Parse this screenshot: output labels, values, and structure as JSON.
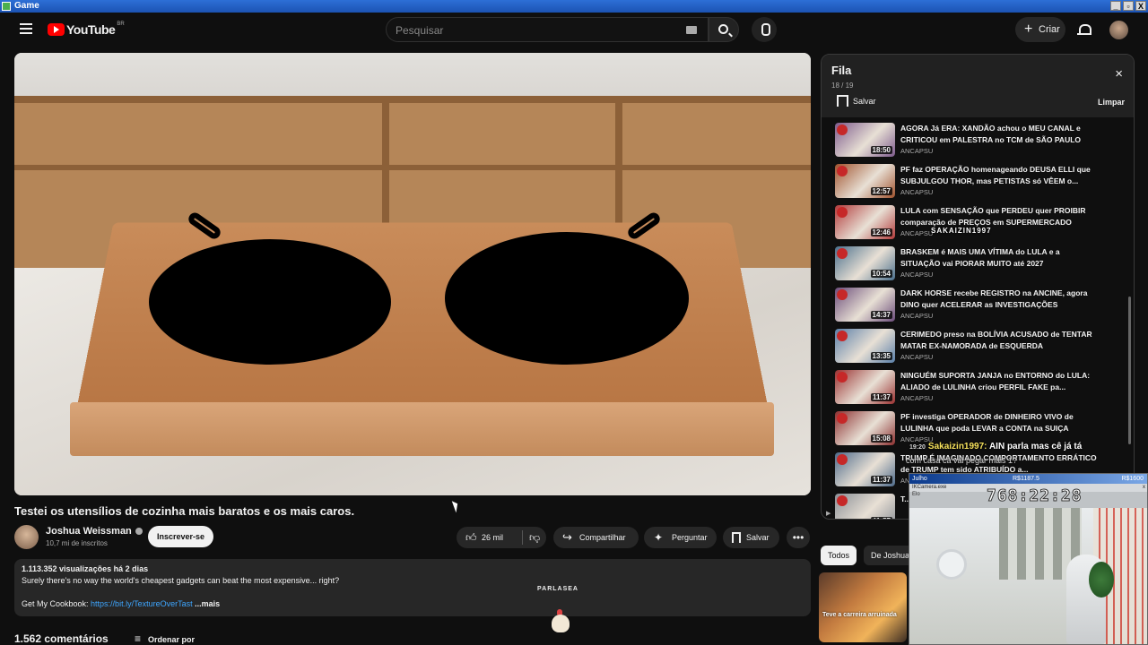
{
  "window": {
    "title": "Game",
    "controls": [
      "_",
      "▫",
      "X"
    ]
  },
  "header": {
    "logo_text": "YouTube",
    "country_code": "BR",
    "search_placeholder": "Pesquisar",
    "create_label": "Criar"
  },
  "video": {
    "title": "Testei os utensílios de cozinha mais baratos e os mais caros.",
    "channel": "Joshua Weissman",
    "subscribers": "10,7 mi de inscritos",
    "subscribe_label": "Inscrever-se",
    "likes": "26 mil",
    "share_label": "Compartilhar",
    "ask_label": "Perguntar",
    "save_label": "Salvar",
    "more_label": "•••"
  },
  "description": {
    "stats": "1.113.352 visualizações  há 2 dias",
    "text": "Surely there's no way the world's cheapest gadgets can beat the most expensive... right?",
    "cookbook_prefix": "Get My Cookbook: ",
    "cookbook_link": "https://bit.ly/TextureOverTast",
    "more": "...mais"
  },
  "comments": {
    "count": "1.562 comentários",
    "sort_label": "Ordenar por"
  },
  "queue": {
    "title": "Fila",
    "position": "18 / 19",
    "save_label": "Salvar",
    "clear_label": "Limpar",
    "close_icon": "×",
    "items": [
      {
        "title": "AGORA Já ERA: XANDÃO achou o MEU CANAL e CRITICOU em PALESTRA no TCM de SÃO PAULO",
        "channel": "ANCAPSU",
        "duration": "18:50",
        "thumb_color": "#7d5a8c"
      },
      {
        "title": "PF faz OPERAÇÃO homenageando DEUSA ELLI que SUBJULGOU THOR, mas PETISTAS só VÊEM o...",
        "channel": "ANCAPSU",
        "duration": "12:57",
        "thumb_color": "#a0522d"
      },
      {
        "title": "LULA com SENSAÇÃO que PERDEU quer PROIBIR comparação de PREÇOS em SUPERMERCADO",
        "channel": "ANCAPSU",
        "duration": "12:46",
        "thumb_color": "#b23a3a"
      },
      {
        "title": "BRASKEM é MAIS UMA VÍTIMA do LULA e a SITUAÇÃO vai PIORAR MUITO até 2027",
        "channel": "ANCAPSU",
        "duration": "10:54",
        "thumb_color": "#4a6f8c"
      },
      {
        "title": "DARK HORSE recebe REGISTRO na ANCINE, agora DINO quer ACELERAR as INVESTIGAÇÕES",
        "channel": "ANCAPSU",
        "duration": "14:37",
        "thumb_color": "#6b4c7a"
      },
      {
        "title": "CERIMEDO preso na BOLÍVIA ACUSADO de TENTAR MATAR EX-NAMORADA de ESQUERDA",
        "channel": "ANCAPSU",
        "duration": "13:35",
        "thumb_color": "#5a7fa8"
      },
      {
        "title": "NINGUÉM SUPORTA JANJA no ENTORNO do LULA: ALIADO de LULINHA criou PERFIL FAKE pa...",
        "channel": "ANCAPSU",
        "duration": "11:37",
        "thumb_color": "#9a3030"
      },
      {
        "title": "PF investiga OPERADOR de DINHEIRO VIVO de LULINHA que poda LEVAR a CONTA na SUIÇA",
        "channel": "ANCAPSU",
        "duration": "15:08",
        "thumb_color": "#8c2f2f"
      },
      {
        "title": "TRUMP É IMAGINADO COMPORTAMENTO ERRÁTICO de TRUMP tem sido ATRIBUÍDO a...",
        "channel": "ANCAPSU",
        "duration": "11:37",
        "thumb_color": "#4d6a8a"
      },
      {
        "title": "T...",
        "channel": "",
        "duration": "41:57",
        "thumb_color": "#8a8f96"
      }
    ]
  },
  "chips": {
    "all": "Todos",
    "other": "De Joshua"
  },
  "recommendation": {
    "title_overlay": "Teve a carreira arruinada"
  },
  "stream_overlay": {
    "chat_time": "19:20",
    "chat_user": "Sakaizin1997:",
    "chat_message": "AIN parla mas cê já tá",
    "chat_line2": "com casa ca vai pegar mais 1?",
    "floating_name": "SAKAIZIN1997",
    "parlasea": "PARLASEA",
    "cam_month": "Julho",
    "cam_value1": "R$1187.5",
    "cam_value2": "R$1600",
    "cam_window_title": "IKCamera.exe",
    "cam_sub": "Elo",
    "timer": "768:22:28"
  }
}
